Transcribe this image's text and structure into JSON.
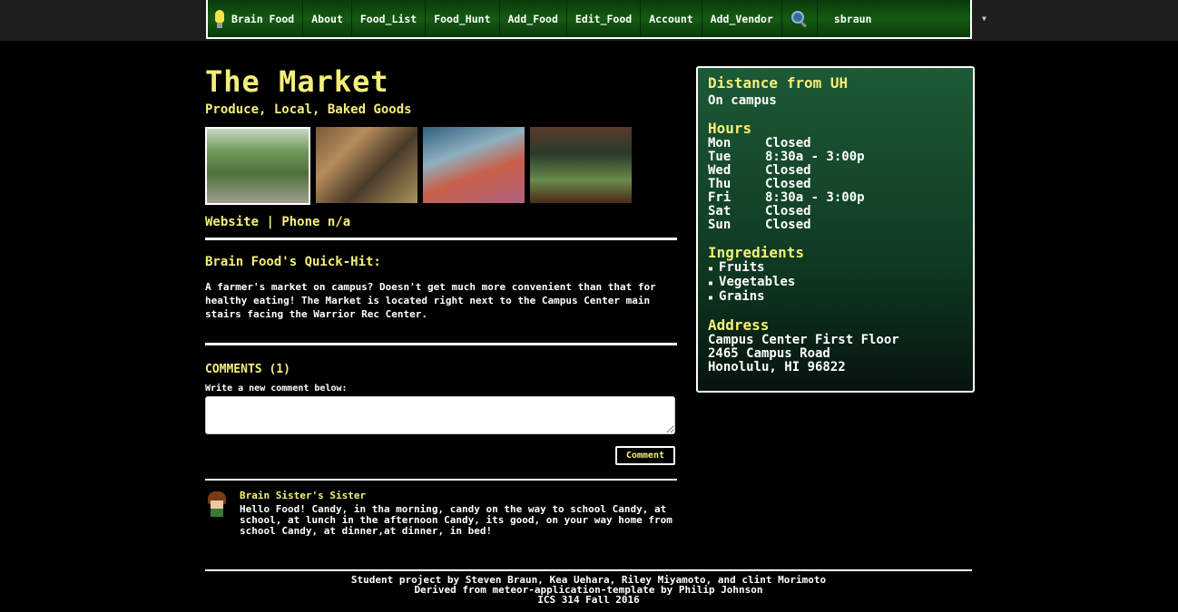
{
  "nav": {
    "brand": "Brain Food",
    "items": [
      "About",
      "Food_List",
      "Food_Hunt",
      "Add_Food",
      "Edit_Food",
      "Account",
      "Add_Vendor"
    ],
    "search_icon": "search-icon",
    "user": "sbraun"
  },
  "page": {
    "title": "The Market",
    "subtitle": "Produce, Local, Baked Goods",
    "website_label": "Website",
    "separator": "|",
    "phone": "Phone n/a"
  },
  "quickhit": {
    "heading": "Brain Food's Quick-Hit:",
    "text": "A farmer's market on campus? Doesn't get much more convenient than that for healthy eating! The Market is located right next to the Campus Center main stairs facing the Warrior Rec Center."
  },
  "comments": {
    "heading": "COMMENTS (1)",
    "write_label": "Write a new comment below:",
    "textarea_value": "",
    "button_label": "Comment",
    "items": [
      {
        "author": "Brain Sister's Sister",
        "text": "Hello Food! Candy, in tha morning, candy on the way to school Candy, at school, at lunch in the afternoon Candy, its good, on your way home from school Candy, at dinner,at dinner, in bed!"
      }
    ]
  },
  "sidebar": {
    "distance_heading": "Distance from UH",
    "distance": "On campus",
    "hours_heading": "Hours",
    "hours": [
      {
        "day": "Mon",
        "time": "Closed"
      },
      {
        "day": "Tue",
        "time": "8:30a - 3:00p"
      },
      {
        "day": "Wed",
        "time": "Closed"
      },
      {
        "day": "Thu",
        "time": "Closed"
      },
      {
        "day": "Fri",
        "time": "8:30a - 3:00p"
      },
      {
        "day": "Sat",
        "time": "Closed"
      },
      {
        "day": "Sun",
        "time": "Closed"
      }
    ],
    "ingredients_heading": "Ingredients",
    "ingredients": [
      "Fruits",
      "Vegetables",
      "Grains"
    ],
    "address_heading": "Address",
    "address_lines": [
      "Campus Center First Floor",
      "2465 Campus Road",
      "Honolulu, HI 96822"
    ]
  },
  "footer": {
    "lines": [
      "Student project by Steven Braun, Kea Uehara, Riley Miyamoto, and clint Morimoto",
      "Derived from meteor-application-template by Philip Johnson",
      "ICS 314 Fall 2016"
    ]
  },
  "colors": {
    "accent_yellow": "#f5ef7a",
    "nav_green": "#145a14",
    "sidebar_green": "#1d5a36",
    "background": "#000000"
  }
}
